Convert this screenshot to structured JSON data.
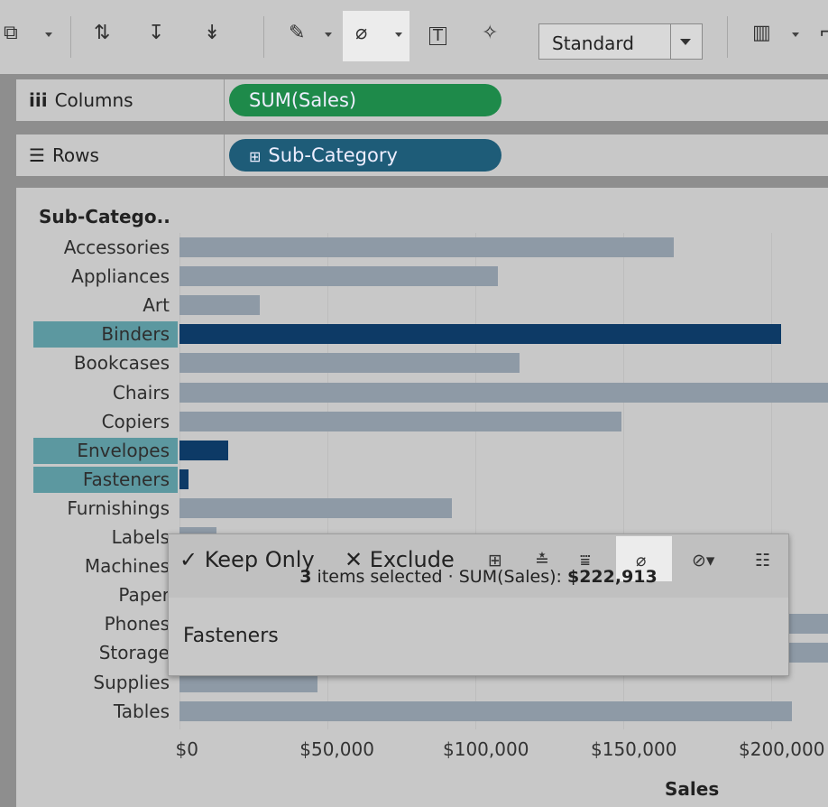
{
  "toolbar": {
    "icons": [
      "clear-sheet-icon",
      "swap-icon",
      "sort-ascending-icon",
      "sort-descending-icon",
      "highlight-icon",
      "annotate-icon",
      "label-icon",
      "pin-icon",
      "show-me-icon"
    ],
    "fit_dropdown": {
      "selected": "Standard"
    }
  },
  "shelves": {
    "columns": {
      "label": "Columns",
      "pill": "SUM(Sales)",
      "pill_color": "#1e8a4a"
    },
    "rows": {
      "label": "Rows",
      "pill": "Sub-Category",
      "pill_color": "#1e5c78"
    }
  },
  "chart": {
    "header": "Sub-Catego..",
    "xlabel": "Sales",
    "highlight_color": "#0d3a66",
    "dim_color": "#8e9aa6"
  },
  "chart_data": {
    "type": "bar",
    "orientation": "horizontal",
    "categories": [
      "Accessories",
      "Appliances",
      "Art",
      "Binders",
      "Bookcases",
      "Chairs",
      "Copiers",
      "Envelopes",
      "Fasteners",
      "Furnishings",
      "Labels",
      "Machines",
      "Paper",
      "Phones",
      "Storage",
      "Supplies",
      "Tables"
    ],
    "values": [
      167000,
      107500,
      27000,
      203400,
      115000,
      328000,
      149500,
      16500,
      3000,
      92000,
      12500,
      189000,
      78500,
      330000,
      224000,
      46700,
      206900
    ],
    "selected": [
      "Binders",
      "Envelopes",
      "Fasteners"
    ],
    "xlabel": "Sales",
    "ylabel": "Sub-Catego..",
    "xticks": [
      "$0",
      "$50,000",
      "$100,000",
      "$150,000",
      "$200,000"
    ],
    "xlim": [
      0,
      218000
    ]
  },
  "tooltip": {
    "keep_only": "Keep Only",
    "exclude": "Exclude",
    "count": "3",
    "items_selected": "items selected",
    "measure_label": "SUM(Sales):",
    "measure_value": "$222,913",
    "item": "Fasteners"
  }
}
